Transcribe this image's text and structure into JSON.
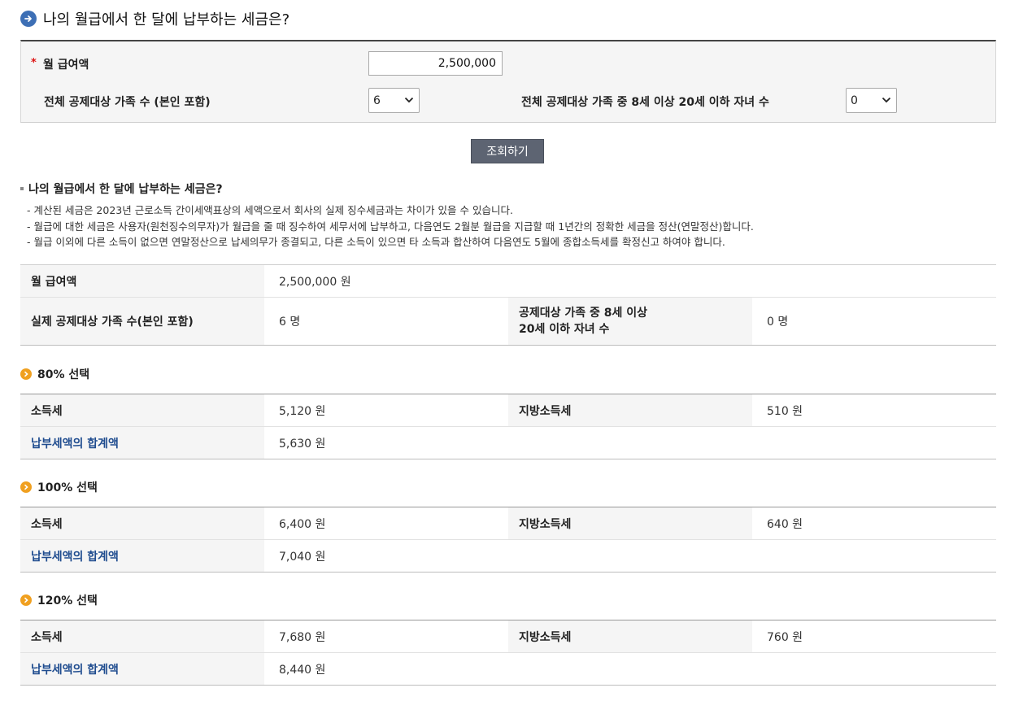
{
  "page_title": "나의 월급에서 한 달에 납부하는 세금은?",
  "form": {
    "salary_label": "월 급여액",
    "salary_value": "2,500,000",
    "family_label": "전체 공제대상 가족 수 (본인 포함)",
    "family_value": "6",
    "children_label": "전체 공제대상 가족 중 8세 이상 20세 이하 자녀 수",
    "children_value": "0"
  },
  "query_button": "조회하기",
  "result_title": "나의 월급에서 한 달에 납부하는 세금은?",
  "notes": [
    "- 계산된 세금은  2023년  근로소득 간이세액표상의 세액으로서 회사의 실제 징수세금과는 차이가 있을 수 있습니다.",
    "- 월급에 대한 세금은 사용자(원천징수의무자)가 월급을 줄 때 징수하여 세무서에 납부하고, 다음연도 2월분 월급을 지급할 때 1년간의 정확한 세금을 정산(연말정산)합니다.",
    "- 월급 이외에 다른 소득이 없으면 연말정산으로 납세의무가 종결되고, 다른 소득이 있으면 타 소득과 합산하여 다음연도 5월에 종합소득세를 확정신고 하여야 합니다."
  ],
  "info": {
    "salary_label": "월 급여액",
    "salary_value": "2,500,000  원",
    "family_label": "실제 공제대상 가족 수(본인 포함)",
    "family_value": "6  명",
    "children_label_line1": "공제대상 가족 중 8세 이상",
    "children_label_line2": "20세 이하 자녀 수",
    "children_value": "0  명"
  },
  "sections": [
    {
      "title": "80% 선택",
      "income_tax_label": "소득세",
      "income_tax_value": "5,120  원",
      "local_tax_label": "지방소득세",
      "local_tax_value": "510  원",
      "total_label": "납부세액의 합계액",
      "total_value": "5,630  원"
    },
    {
      "title": "100% 선택",
      "income_tax_label": "소득세",
      "income_tax_value": "6,400  원",
      "local_tax_label": "지방소득세",
      "local_tax_value": "640  원",
      "total_label": "납부세액의 합계액",
      "total_value": "7,040  원"
    },
    {
      "title": "120% 선택",
      "income_tax_label": "소득세",
      "income_tax_value": "7,680  원",
      "local_tax_label": "지방소득세",
      "local_tax_value": "760  원",
      "total_label": "납부세액의 합계액",
      "total_value": "8,440  원"
    }
  ],
  "colors": {
    "accent_blue": "#3d6fb5",
    "button_bg": "#5d6472",
    "section_dot": "#f0a020",
    "sum_label": "#1f4c8f",
    "required_star": "#dd1111"
  }
}
